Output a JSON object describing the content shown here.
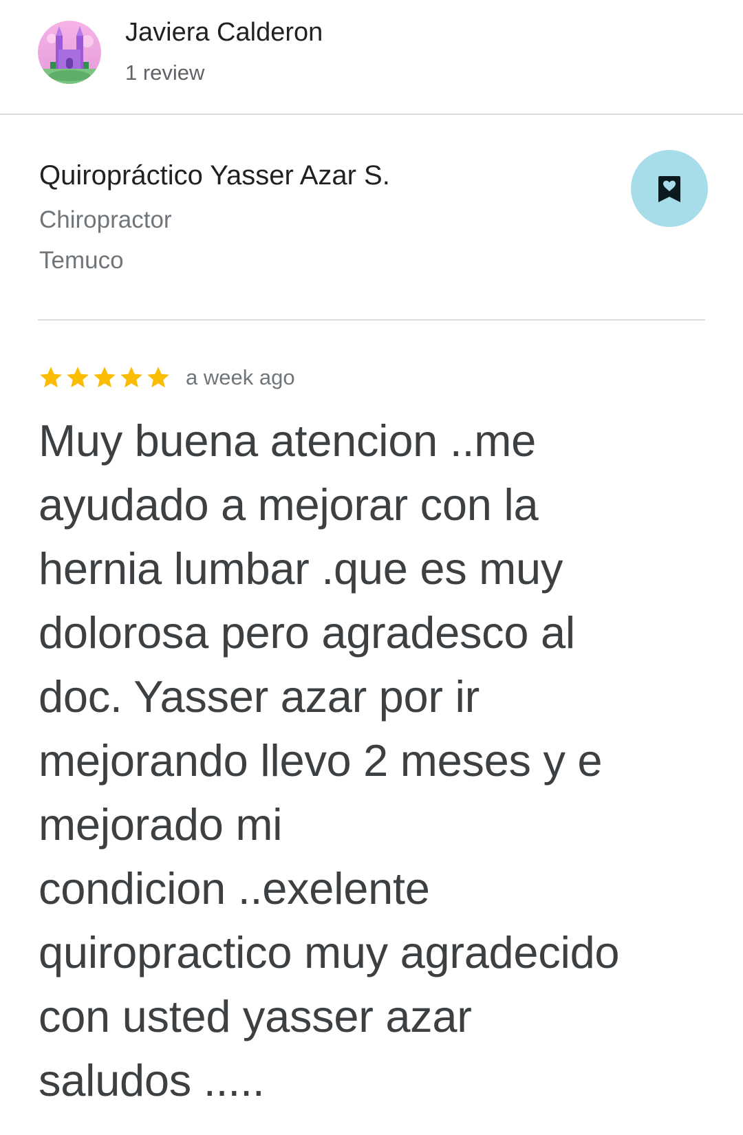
{
  "reviewer": {
    "name": "Javiera Calderon",
    "review_count": "1 review",
    "avatar_icon": "castle-avatar-icon"
  },
  "place": {
    "name": "Quiropráctico Yasser Azar S.",
    "category": "Chiropractor",
    "city": "Temuco",
    "save_icon": "bookmark-heart-icon"
  },
  "review": {
    "stars": 5,
    "stars_max": 5,
    "time": "a week ago",
    "text": "Muy buena atencion ..me\nayudado a mejorar con la\nhernia lumbar .que es muy\ndolorosa pero agradesco al\ndoc. Yasser azar por ir\nmejorando llevo 2 meses y e\nmejorado mi\ncondicion ..exelente\nquiropractico muy agradecido\ncon usted yasser azar\nsaludos ....."
  },
  "colors": {
    "star": "#fbbc04",
    "save_button_bg": "#a7dde9",
    "divider": "#dadce0",
    "primary_text": "#202124",
    "secondary_text": "#70757a"
  }
}
